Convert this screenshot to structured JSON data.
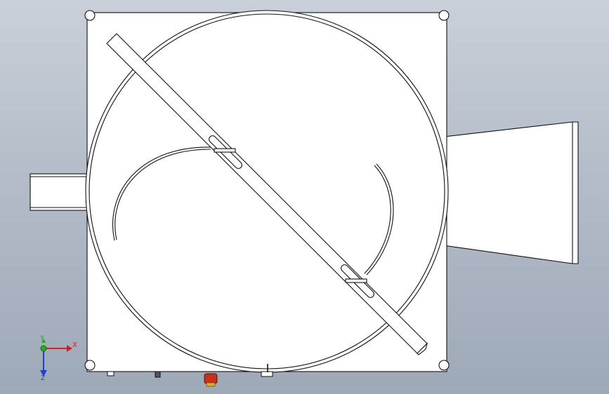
{
  "triad": {
    "x_label": "X",
    "y_label": "Y",
    "z_label": "Z",
    "x_color": "#d42020",
    "y_color": "#22b022",
    "z_color": "#2040c8"
  },
  "colors": {
    "stroke": "#111111",
    "fill": "#ffffff",
    "handle_red": "#c8301c",
    "handle_yellow": "#d8b030"
  }
}
